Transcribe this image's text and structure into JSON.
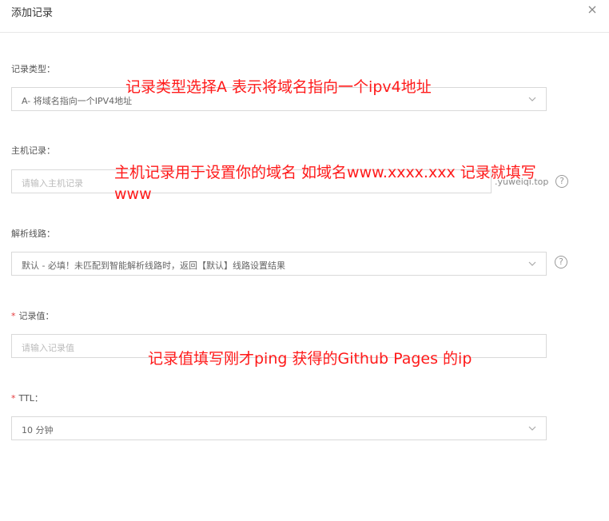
{
  "dialog": {
    "title": "添加记录"
  },
  "fields": {
    "record_type": {
      "label": "记录类型：",
      "value": "A- 将域名指向一个IPV4地址"
    },
    "host": {
      "label": "主机记录：",
      "placeholder": "请输入主机记录",
      "suffix": ".yuweiqi.top"
    },
    "line": {
      "label": "解析线路：",
      "value": "默认 - 必填！未匹配到智能解析线路时，返回【默认】线路设置结果"
    },
    "record_value": {
      "required_mark": "*",
      "label": "记录值：",
      "placeholder": "请输入记录值"
    },
    "ttl": {
      "required_mark": "*",
      "label": "TTL：",
      "value": "10 分钟"
    }
  },
  "annotations": {
    "a1": "记录类型选择A 表示将域名指向一个ipv4地址",
    "a2_line1": "主机记录用于设置你的域名 如域名www.xxxx.xxx  记录就填写",
    "a2_line2": "www",
    "a3": "记录值填写刚才ping 获得的Github Pages 的ip"
  },
  "icons": {
    "close": "close-icon",
    "help": "question-circle-icon",
    "dropdown": "chevron-down-icon"
  },
  "colors": {
    "annotation": "#ff1a1a",
    "required": "#e4393c",
    "border": "#d9d9d9"
  }
}
